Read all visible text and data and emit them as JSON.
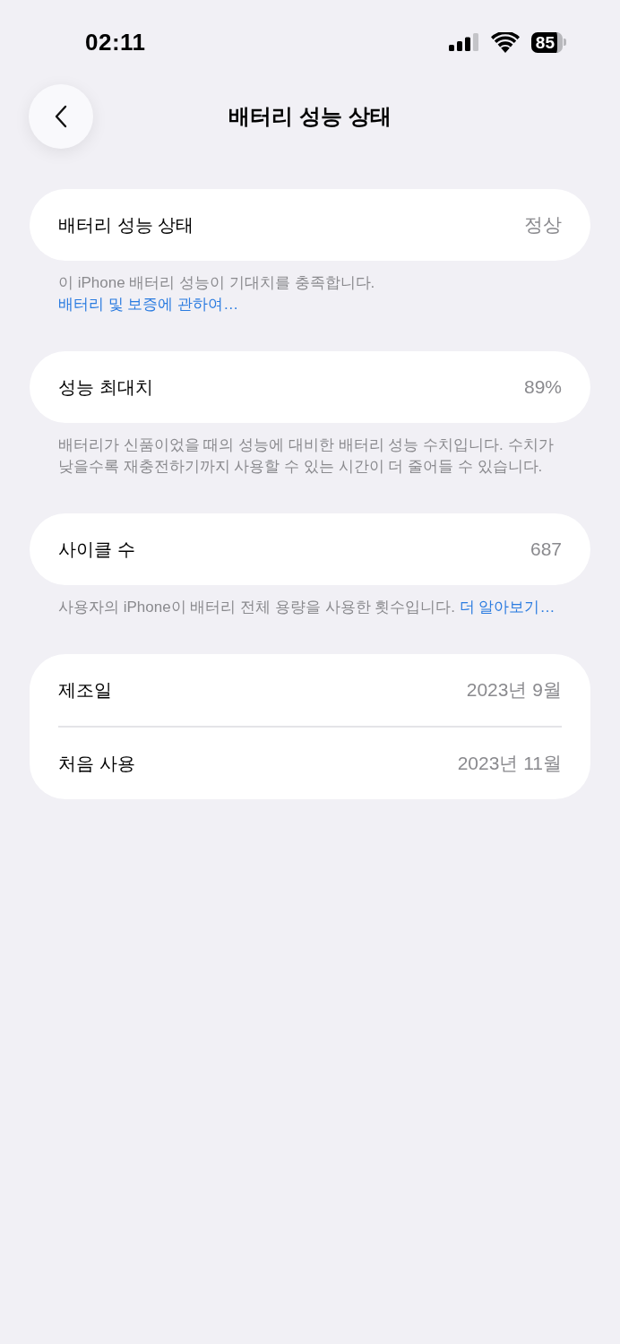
{
  "status_bar": {
    "time": "02:11",
    "battery_percent": "85"
  },
  "nav": {
    "title": "배터리 성능 상태"
  },
  "groups": [
    {
      "rows": [
        {
          "label": "배터리 성능 상태",
          "value": "정상"
        }
      ],
      "footer": {
        "text": "이 iPhone 배터리 성능이 기대치를 충족합니다.",
        "link": "배터리 및 보증에 관하여…"
      }
    },
    {
      "rows": [
        {
          "label": "성능 최대치",
          "value": "89%"
        }
      ],
      "footer": {
        "text": "배터리가 신품이었을 때의 성능에 대비한 배터리 성능 수치입니다. 수치가 낮을수록 재충전하기까지 사용할 수 있는 시간이 더 줄어들 수 있습니다."
      }
    },
    {
      "rows": [
        {
          "label": "사이클 수",
          "value": "687"
        }
      ],
      "footer": {
        "text": "사용자의 iPhone이 배터리 전체 용량을 사용한 횟수입니다.",
        "link": "더 알아보기…"
      }
    },
    {
      "rows": [
        {
          "label": "제조일",
          "value": "2023년 9월"
        },
        {
          "label": "처음 사용",
          "value": "2023년 11월"
        }
      ]
    }
  ]
}
